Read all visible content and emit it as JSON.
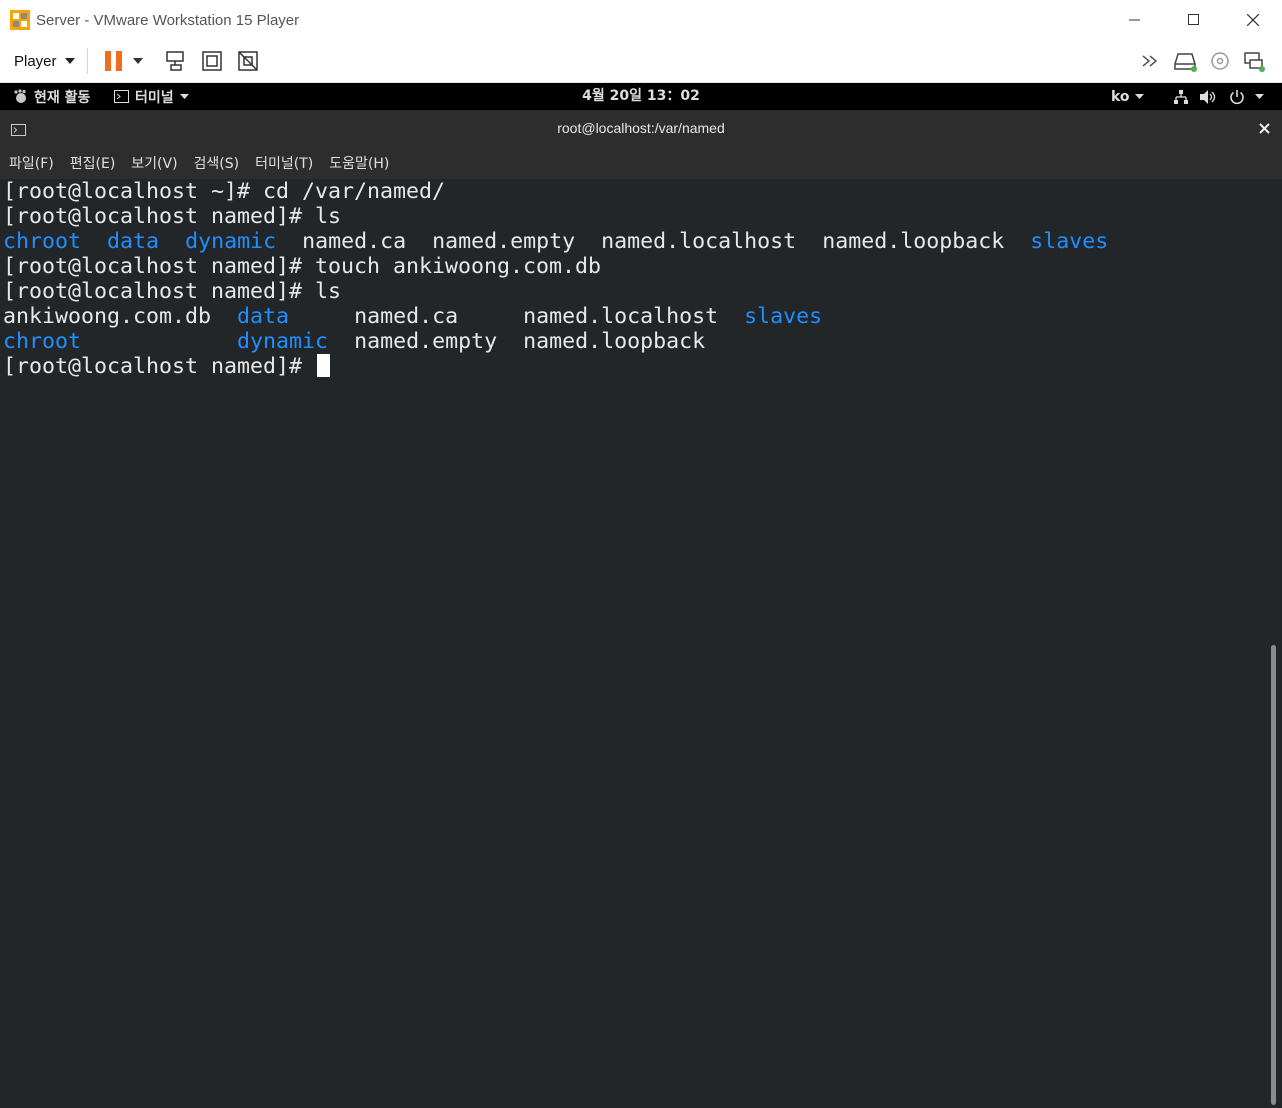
{
  "window": {
    "title": "Server - VMware Workstation 15 Player"
  },
  "toolbar": {
    "player_label": "Player"
  },
  "gnome": {
    "activities": "현재 활동",
    "app_menu": "터미널",
    "clock": "4월 20일 13：02",
    "lang": "ko"
  },
  "terminal": {
    "title": "root@localhost:/var/named",
    "menu": [
      "파일(F)",
      "편집(E)",
      "보기(V)",
      "검색(S)",
      "터미널(T)",
      "도움말(H)"
    ],
    "lines": [
      {
        "prompt": "[root@localhost ~]# ",
        "cmd": "cd /var/named/"
      },
      {
        "prompt": "[root@localhost named]# ",
        "cmd": "ls"
      },
      {
        "ls1": {
          "chroot": "chroot",
          "data": "data",
          "dynamic": "dynamic",
          "named_ca": "named.ca",
          "named_empty": "named.empty",
          "named_localhost": "named.localhost",
          "named_loopback": "named.loopback",
          "slaves": "slaves"
        }
      },
      {
        "prompt": "[root@localhost named]# ",
        "cmd": "touch ankiwoong.com.db"
      },
      {
        "prompt": "[root@localhost named]# ",
        "cmd": "ls"
      },
      {
        "ls2a": {
          "db": "ankiwoong.com.db",
          "data": "data",
          "named_ca": "named.ca",
          "named_localhost": "named.localhost",
          "slaves": "slaves"
        }
      },
      {
        "ls2b": {
          "chroot": "chroot",
          "dynamic": "dynamic",
          "named_empty": "named.empty",
          "named_loopback": "named.loopback"
        }
      },
      {
        "prompt": "[root@localhost named]# ",
        "cmd": ""
      }
    ]
  },
  "colors": {
    "terminal_bg": "#232629",
    "dir_blue": "#1f8fff",
    "pause_orange": "#f26b21"
  }
}
